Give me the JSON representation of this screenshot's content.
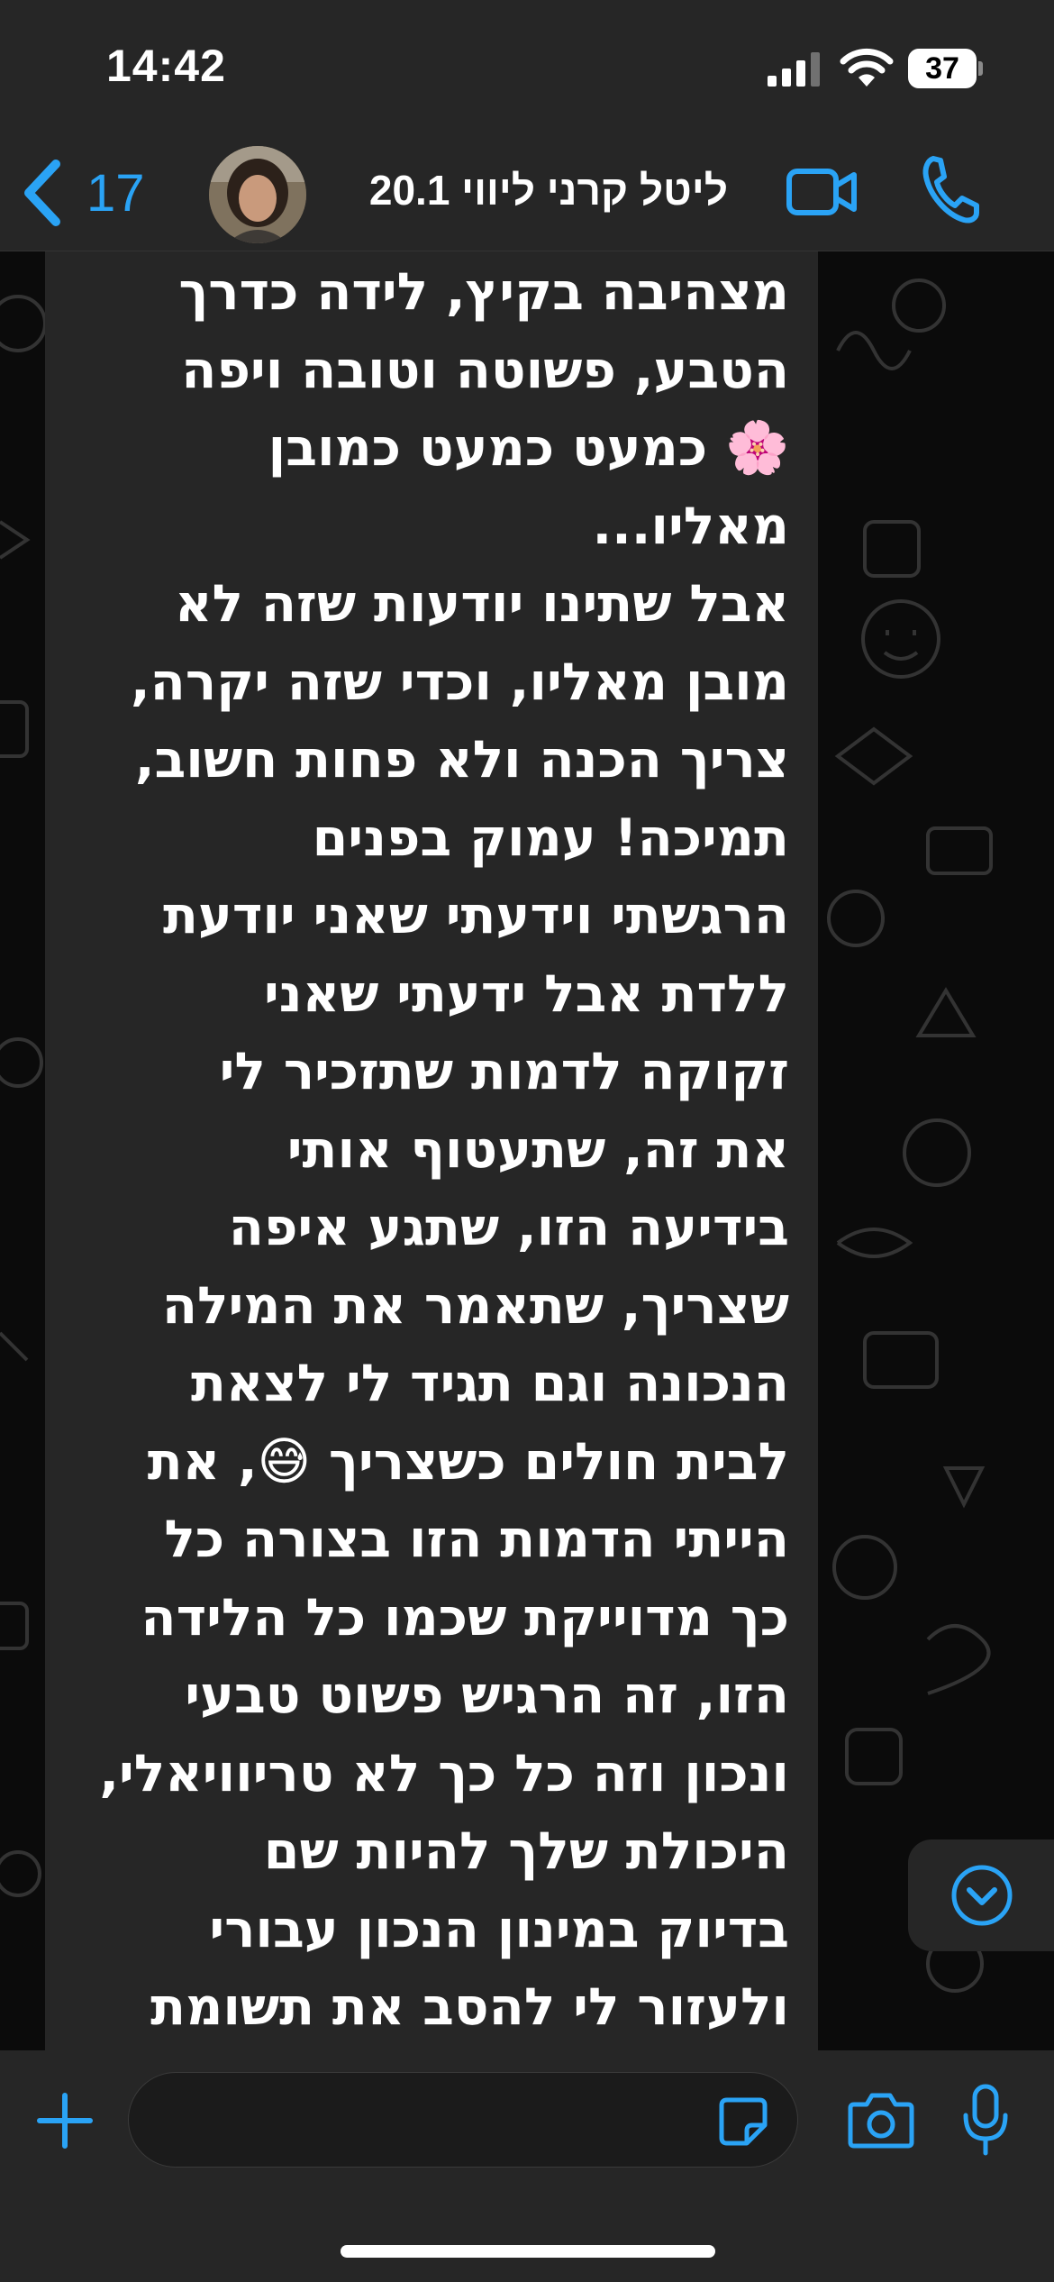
{
  "status_bar": {
    "time": "14:42",
    "battery_level": "37",
    "icons": [
      "signal-icon",
      "wifi-icon",
      "battery-icon"
    ]
  },
  "header": {
    "back_icon": "chevron-left-icon",
    "unread_count": "17",
    "contact_name": "ליטל קרני ליווי 20.1",
    "video_call_icon": "video-camera-icon",
    "voice_call_icon": "phone-icon"
  },
  "message": {
    "text": "מצהיבה בקיץ, לידה כדרך\nהטבע, פשוטה וטובה ויפה\n🌸 כמעט כמעט כמובן\nמאליו...\nאבל שתינו יודעות שזה לא\nמובן מאליו, וכדי שזה יקרה,\nצריך הכנה ולא פחות חשוב,\nתמיכה! עמוק בפנים\nהרגשתי וידעתי שאני יודעת\nללדת אבל ידעתי שאני\nזקוקה לדמות שתזכיר לי\nאת זה, שתעטוף אותי\nבידיעה הזו, שתגע איפה\nשצריך, שתאמר את המילה\nהנכונה וגם תגיד לי לצאת\nלבית חולים כשצריך 😅, את\nהייתי הדמות הזו בצורה כל\nכך מדוייקת שכמו כל הלידה\nהזו, זה הרגיש פשוט טבעי\nונכון וזה כל כך לא טריוויאלי,\nהיכולת שלך להיות שם\nבדיוק במינון הנכון עבורי\nולעזור לי להסב את תשומת"
  },
  "scroll_button": {
    "icon": "chevron-down-circle-icon"
  },
  "input_bar": {
    "attach_icon": "plus-icon",
    "placeholder": "",
    "sticker_icon": "sticker-icon",
    "camera_icon": "camera-icon",
    "mic_icon": "microphone-icon"
  },
  "colors": {
    "accent": "#2AA3F5",
    "bar_background": "#262626",
    "bubble_background": "#262626",
    "chat_background": "#0B0B0B"
  }
}
